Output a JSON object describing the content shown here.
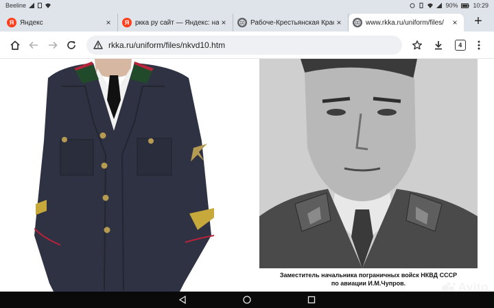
{
  "status_bar": {
    "carrier": "Beeline",
    "battery": "90%",
    "time": "10:29"
  },
  "tabs": [
    {
      "title": "Яндекс",
      "favicon": "yandex-icon",
      "close": "×"
    },
    {
      "title": "ркка ру сайт — Яндекс: на",
      "favicon": "yandex-icon",
      "close": "×"
    },
    {
      "title": "Рабоче-Крестьянская Крас",
      "favicon": "globe-icon",
      "close": "×"
    },
    {
      "title": "www.rkka.ru/uniform/files/",
      "favicon": "globe-icon",
      "close": "×",
      "active": true
    }
  ],
  "new_tab_label": "+",
  "toolbar": {
    "url": "rkka.ru/uniform/files/nkvd10.htm",
    "tab_count": "4"
  },
  "page": {
    "left_image": "nkvd-uniform-jacket-photo",
    "right_image": "portrait-photo",
    "caption_line1": "Заместитель начальника пограничных войск НКВД СССР",
    "caption_line2": "по авиации И.М.Чупров."
  },
  "watermark": {
    "text": "Avito"
  },
  "colors": {
    "chrome": "#dfe3ea",
    "omnibox": "#eef0f3",
    "yandex": "#fc3f1d",
    "nav": "#0a0a0a"
  }
}
